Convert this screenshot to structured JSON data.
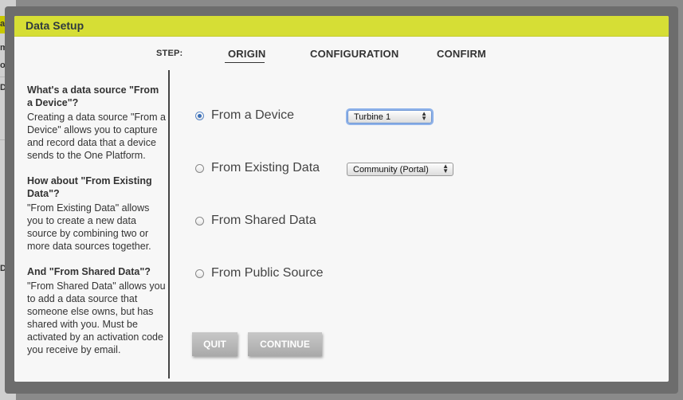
{
  "background": {
    "snippets": [
      "ata",
      "me",
      "ort",
      "De",
      "De"
    ]
  },
  "dialog": {
    "title": "Data Setup",
    "steps": {
      "label": "Step:",
      "items": [
        {
          "label": "Origin",
          "active": true
        },
        {
          "label": "Configuration",
          "active": false
        },
        {
          "label": "Confirm",
          "active": false
        }
      ]
    },
    "help": [
      {
        "heading": "What's a data source \"From a Device\"?",
        "body": "Creating a data source \"From a Device\" allows you to capture and record data that a device sends to the One Platform."
      },
      {
        "heading": "How about \"From Existing Data\"?",
        "body": "\"From Existing Data\" allows you to create a new data source by combining two or more data sources together."
      },
      {
        "heading": "And \"From Shared Data\"?",
        "body": "\"From Shared Data\" allows you to add a data source that someone else owns, but has shared with you. Must be activated by an activation code you receive by email."
      }
    ],
    "options": [
      {
        "label": "From a Device",
        "checked": true,
        "select": "Turbine 1"
      },
      {
        "label": "From Existing Data",
        "checked": false,
        "select": "Community (Portal)"
      },
      {
        "label": "From Shared Data",
        "checked": false
      },
      {
        "label": "From Public Source",
        "checked": false
      }
    ],
    "buttons": {
      "quit": "Quit",
      "continue": "Continue"
    }
  },
  "colors": {
    "titlebar": "#d6de35",
    "radio_selected": "#3a6fb8"
  }
}
